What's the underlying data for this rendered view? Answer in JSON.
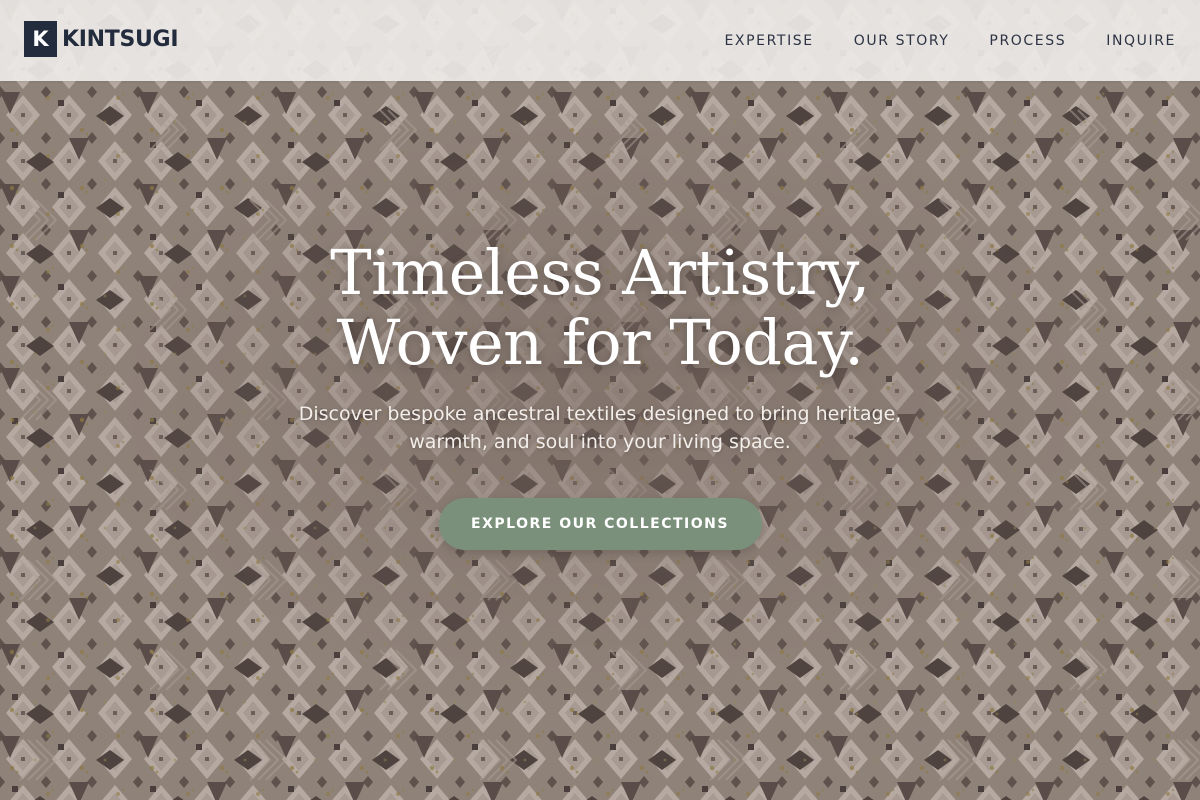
{
  "brand": {
    "mark": "K",
    "name": "KINTSUGI"
  },
  "nav": {
    "items": [
      {
        "label": "EXPERTISE"
      },
      {
        "label": "OUR STORY"
      },
      {
        "label": "PROCESS"
      },
      {
        "label": "INQUIRE"
      }
    ]
  },
  "hero": {
    "headline_line1": "Timeless Artistry,",
    "headline_line2": "Woven for Today.",
    "subtitle": "Discover bespoke ancestral textiles designed to bring heritage, warmth, and soul into your living space.",
    "cta_label": "EXPLORE OUR COLLECTIONS"
  },
  "colors": {
    "navbar_bg": "#ecebe8",
    "brand_dark": "#232c3d",
    "cta_green": "#7a907a",
    "pattern_base": "#8f8279",
    "pattern_light": "#b9ada5",
    "pattern_dark": "#5c4e4a",
    "pattern_gold": "#8a7643"
  }
}
